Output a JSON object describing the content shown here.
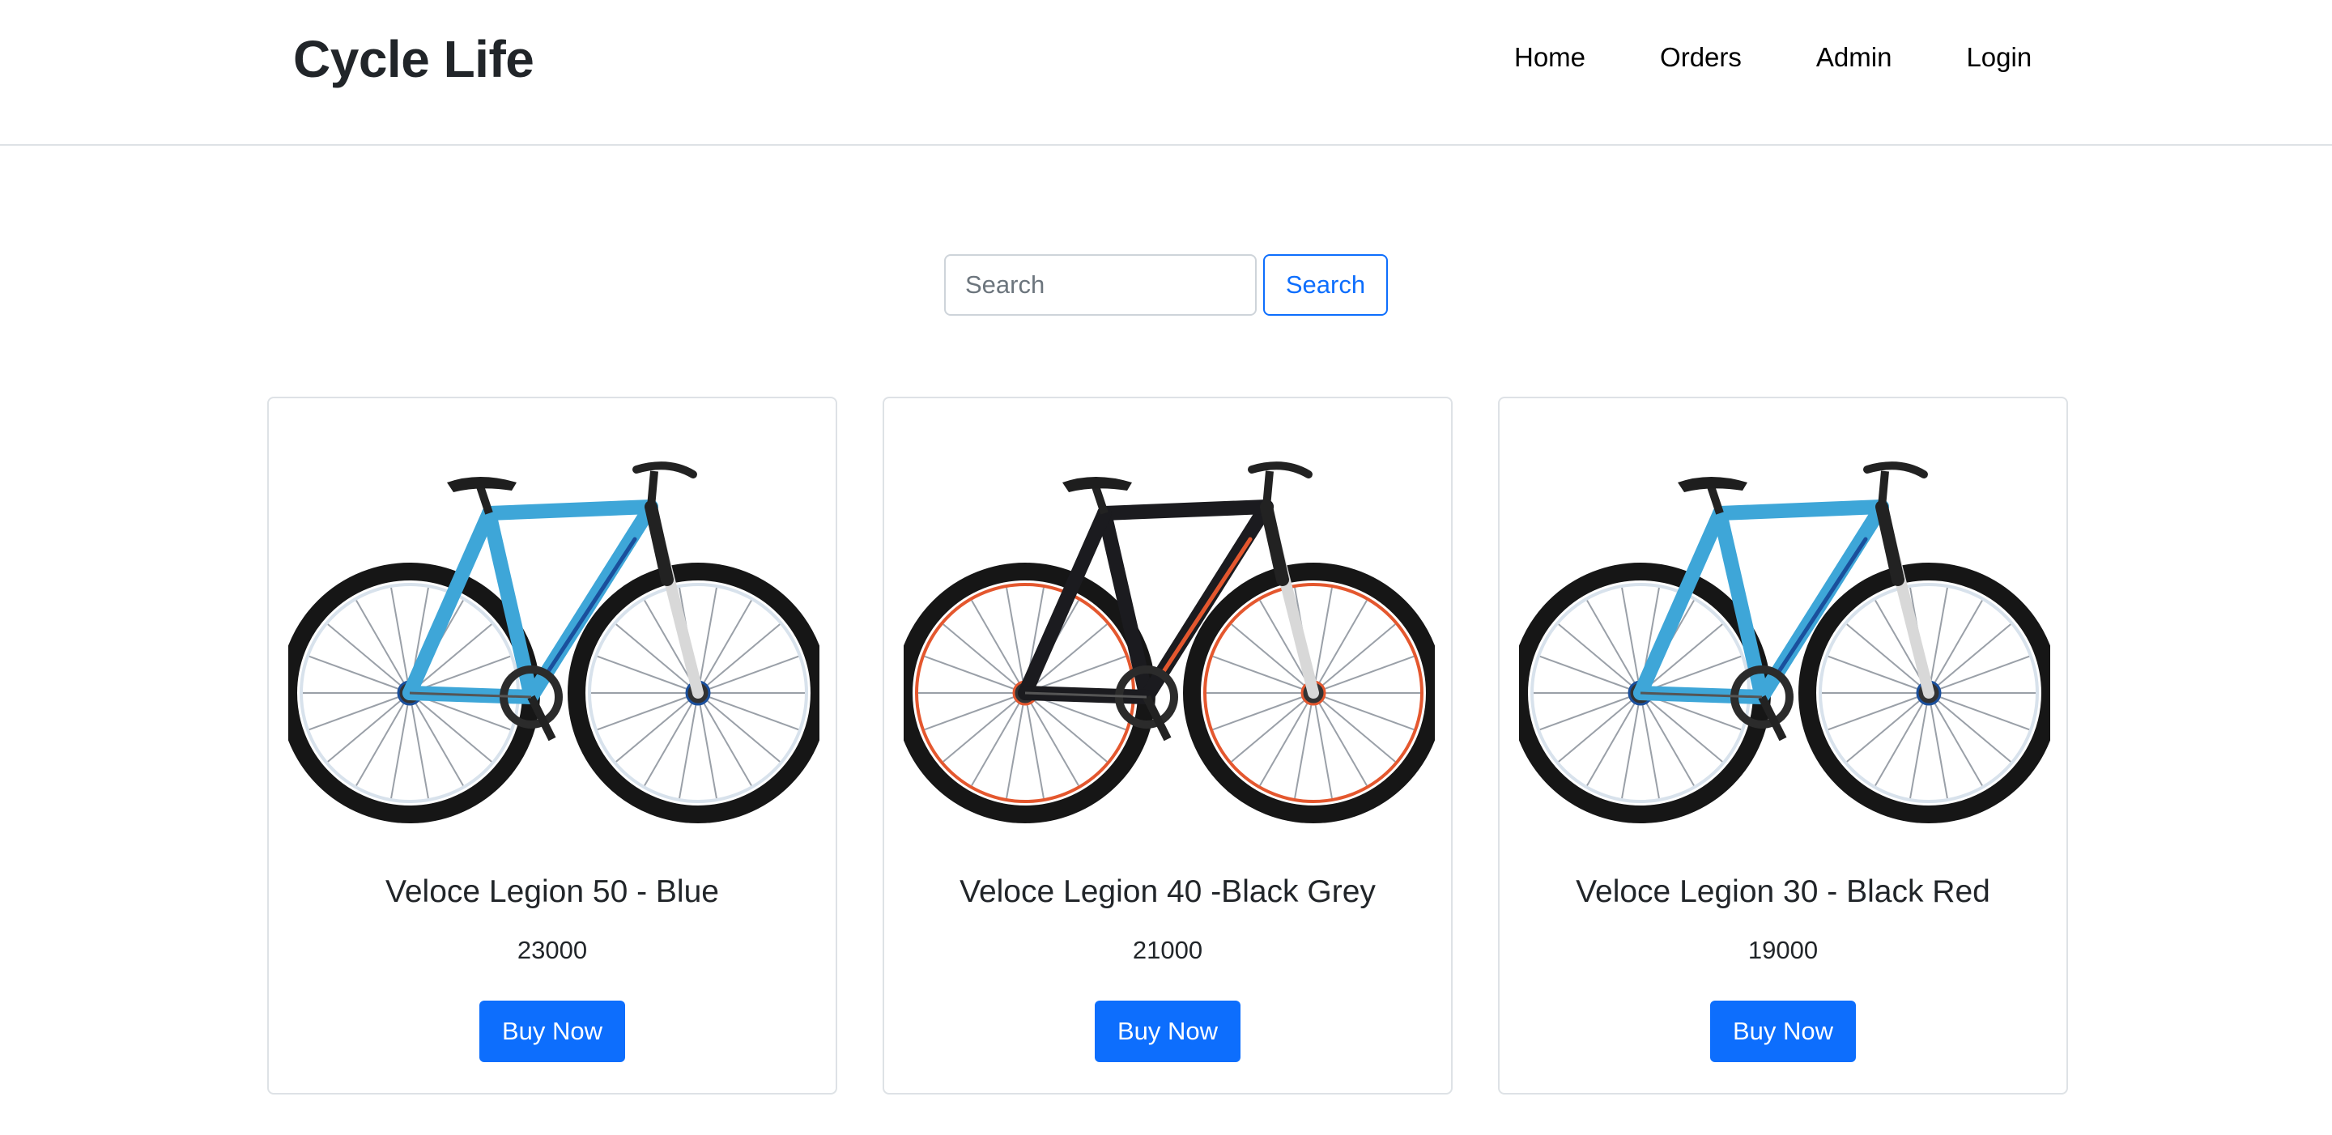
{
  "brand": "Cycle Life",
  "nav": {
    "items": [
      {
        "label": "Home"
      },
      {
        "label": "Orders"
      },
      {
        "label": "Admin"
      },
      {
        "label": "Login"
      }
    ]
  },
  "search": {
    "placeholder": "Search",
    "value": "",
    "button_label": "Search"
  },
  "products": [
    {
      "name": "Veloce Legion 50 - Blue",
      "price": "23000",
      "button_label": "Buy Now",
      "image": "bicycle-blue",
      "frame_color": "#3ea6d8",
      "accent_color": "#1a4f9c"
    },
    {
      "name": "Veloce Legion 40 -Black Grey",
      "price": "21000",
      "button_label": "Buy Now",
      "image": "bicycle-black-orange",
      "frame_color": "#1b1b1f",
      "accent_color": "#e4572e"
    },
    {
      "name": "Veloce Legion 30 - Black Red",
      "price": "19000",
      "button_label": "Buy Now",
      "image": "bicycle-blue",
      "frame_color": "#3ea6d8",
      "accent_color": "#1a4f9c"
    }
  ],
  "colors": {
    "primary": "#0d6efd",
    "border": "#dee2e6",
    "text": "#212529"
  }
}
